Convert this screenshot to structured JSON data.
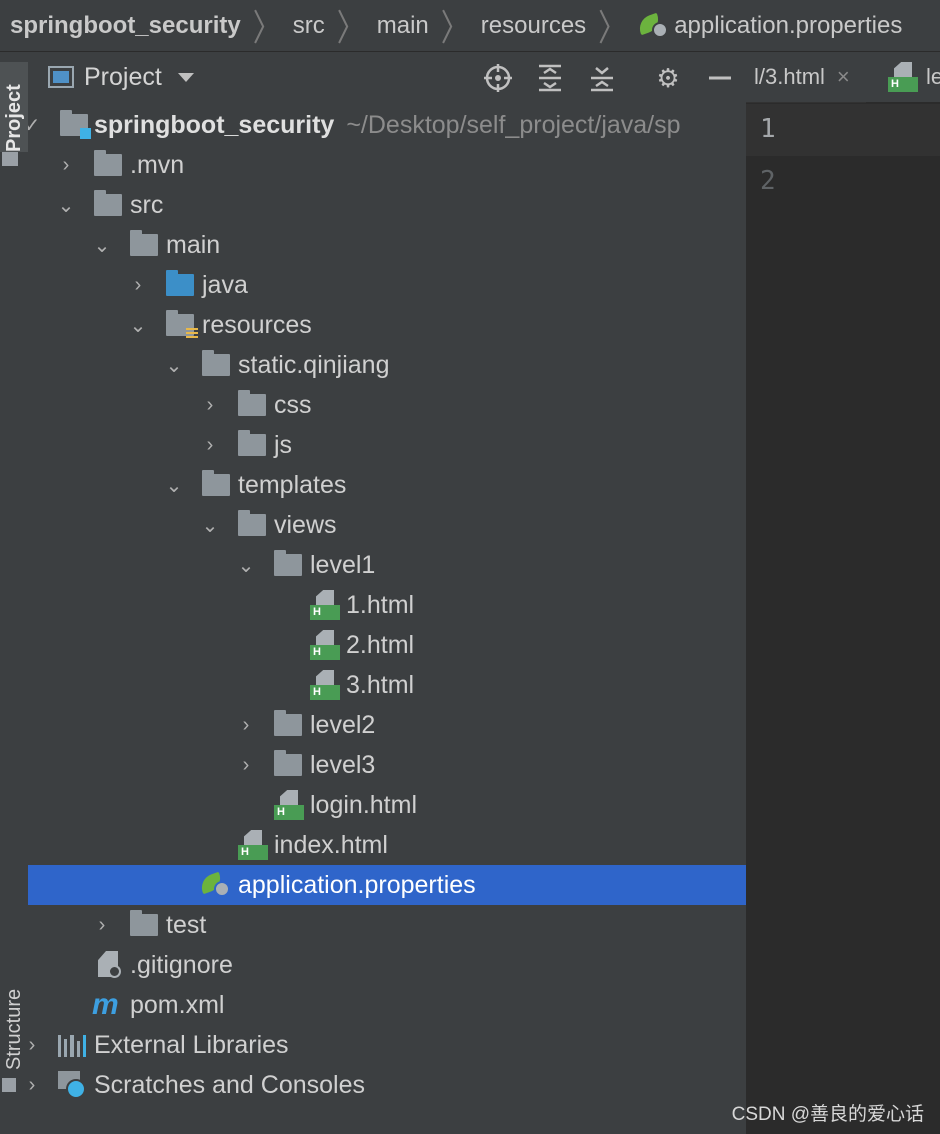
{
  "breadcrumb": {
    "items": [
      "springboot_security",
      "src",
      "main",
      "resources",
      "application.properties"
    ]
  },
  "toolstrip": {
    "project_tab": "Project",
    "structure_tab": "Structure"
  },
  "panel": {
    "title": "Project",
    "icons": [
      "locate-icon",
      "expand-all-icon",
      "collapse-all-icon",
      "gear-icon",
      "minimize-icon"
    ]
  },
  "tree": {
    "root_label": "springboot_security",
    "root_path": "~/Desktop/self_project/java/sp",
    "mvn": ".mvn",
    "src": "src",
    "main": "main",
    "java": "java",
    "resources": "resources",
    "static": "static.qinjiang",
    "css": "css",
    "js": "js",
    "templates": "templates",
    "views": "views",
    "level1": "level1",
    "file1": "1.html",
    "file2": "2.html",
    "file3": "3.html",
    "level2": "level2",
    "level3": "level3",
    "login": "login.html",
    "index": "index.html",
    "app_props": "application.properties",
    "test": "test",
    "gitignore": ".gitignore",
    "pom": "pom.xml",
    "pom_icon_letter": "m",
    "external": "External Libraries",
    "scratches": "Scratches and Consoles"
  },
  "editor": {
    "tab1_label": "l/3.html",
    "tab1_close": "×",
    "tab2_label": "le",
    "line_numbers": [
      "1",
      "2"
    ]
  },
  "watermark": "CSDN @善良的爱心话",
  "colors": {
    "selection": "#2f65ca",
    "panel": "#3c3f41",
    "editor": "#2b2b2b",
    "html_badge": "#499c54"
  }
}
